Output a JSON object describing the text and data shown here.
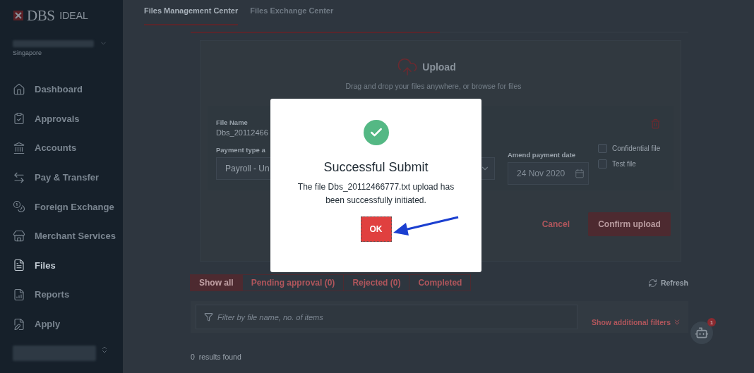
{
  "sidebar": {
    "logo": {
      "brand": "DBS",
      "product": "IDEAL"
    },
    "account": {
      "region": "Singapore"
    },
    "nav_items": [
      {
        "label": "Dashboard",
        "selected": false
      },
      {
        "label": "Approvals",
        "selected": false
      },
      {
        "label": "Accounts",
        "selected": false
      },
      {
        "label": "Pay & Transfer",
        "selected": false
      },
      {
        "label": "Foreign Exchange",
        "selected": false
      },
      {
        "label": "Merchant Services",
        "selected": false
      },
      {
        "label": "Files",
        "selected": true
      },
      {
        "label": "Reports",
        "selected": false
      },
      {
        "label": "Apply",
        "selected": false
      }
    ]
  },
  "tabs": [
    {
      "label": "Files Management Center",
      "selected": true
    },
    {
      "label": "Files Exchange Center",
      "selected": false
    }
  ],
  "upload_progress": {
    "level": 0.5
  },
  "upload": {
    "title": "Upload",
    "hint": "Drag and drop your files anywhere, or browse for files",
    "file": {
      "name_label": "File Name",
      "name_value": "Dbs_20112466",
      "payment_type_label": "Payment type a",
      "payment_type_value": "Payroll - Un",
      "date_label": "Amend payment date",
      "date_value": "24 Nov 2020",
      "options": [
        {
          "label": "Confidential file",
          "checked": false
        },
        {
          "label": "Test file",
          "checked": false
        }
      ]
    },
    "cancel": "Cancel",
    "confirm": "Confirm upload"
  },
  "filter_tabs": [
    {
      "label": "Show all",
      "selected": true
    },
    {
      "label": "Pending approval (0)",
      "selected": false
    },
    {
      "label": "Rejected (0)",
      "selected": false
    },
    {
      "label": "Completed",
      "selected": false
    }
  ],
  "refresh": "Refresh",
  "filter": {
    "placeholder": "Filter by file name, no. of items"
  },
  "additional_filters": "Show additional filters",
  "chat_badge": "1",
  "results": "0  results found",
  "dialog": {
    "title": "Successful Submit",
    "message": "The file Dbs_20112466777.txt upload has been successfully initiated.",
    "ok": "OK"
  }
}
